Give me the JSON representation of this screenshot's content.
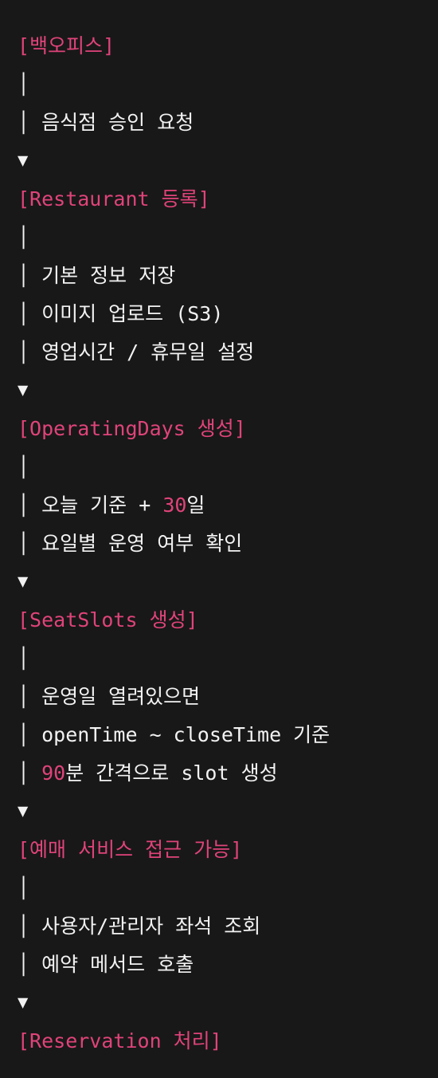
{
  "steps": [
    {
      "heading": "[백오피스]",
      "lines": [
        "│",
        "│ 음식점 승인 요청"
      ],
      "arrow": "▼"
    },
    {
      "heading": "[Restaurant 등록]",
      "lines": [
        "│",
        "│ 기본 정보 저장",
        "│ 이미지 업로드 (S3)",
        "│ 영업시간 / 휴무일 설정"
      ],
      "arrow": "▼"
    },
    {
      "heading": "[OperatingDays 생성]",
      "lines": [
        "│",
        "│ 요일별 운영 여부 확인"
      ],
      "special_line": {
        "prefix": "│ 오늘 기준 + ",
        "number": "30",
        "suffix": "일"
      },
      "arrow": "▼"
    },
    {
      "heading": "[SeatSlots 생성]",
      "lines": [
        "│",
        "│ 운영일 열려있으면",
        "│ openTime ~ closeTime 기준"
      ],
      "special_line": {
        "prefix": "│ ",
        "number": "90",
        "suffix": "분 간격으로 slot 생성"
      },
      "arrow": "▼"
    },
    {
      "heading": "[예매 서비스 접근 가능]",
      "lines": [
        "│",
        "│ 사용자/관리자 좌석 조회",
        "│ 예약 메서드 호출"
      ],
      "arrow": "▼"
    },
    {
      "heading": "[Reservation 처리]"
    }
  ],
  "colors": {
    "background": "#181818",
    "heading": "#e0437a",
    "text": "#f2f2f2"
  }
}
